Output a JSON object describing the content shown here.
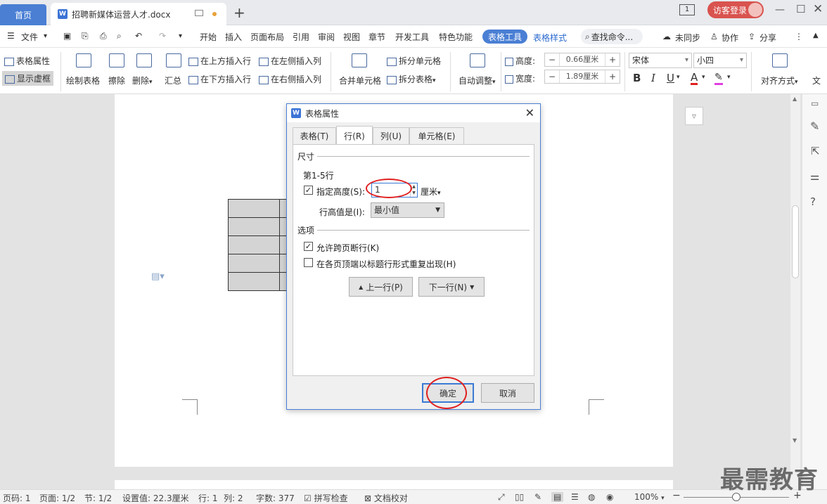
{
  "titlebar": {
    "home_tab": "首页",
    "doc_tab": "招聘新媒体运营人才.docx",
    "new_tab": "+",
    "page_badge": "1",
    "login": "访客登录"
  },
  "menubar": {
    "file": "文件",
    "items": [
      "开始",
      "插入",
      "页面布局",
      "引用",
      "审阅",
      "视图",
      "章节",
      "开发工具",
      "特色功能"
    ],
    "table_tools": "表格工具",
    "table_style": "表格样式",
    "search": "查找命令...",
    "sync": "未同步",
    "collab": "协作",
    "share": "分享"
  },
  "ribbon": {
    "table_props": "表格属性",
    "show_grid": "显示虚框",
    "draw_table": "绘制表格",
    "erase": "擦除",
    "delete": "删除",
    "summary": "汇总",
    "insert_above": "在上方插入行",
    "insert_below": "在下方插入行",
    "insert_left": "在左侧插入列",
    "insert_right": "在右侧插入列",
    "merge": "合并单元格",
    "split_cell": "拆分单元格",
    "split_table": "拆分表格",
    "autofit": "自动调整",
    "height_label": "高度:",
    "height_value": "0.66厘米",
    "width_label": "宽度:",
    "width_value": "1.89厘米",
    "font": "宋体",
    "font_size": "小四",
    "bold": "B",
    "italic": "I",
    "underline": "U",
    "font_color": "A",
    "align": "对齐方式",
    "text_dir": "文"
  },
  "dialog": {
    "title": "表格属性",
    "tabs": [
      "表格(T)",
      "行(R)",
      "列(U)",
      "单元格(E)"
    ],
    "active_tab": 1,
    "section_size": "尺寸",
    "rows_label": "第1-5行",
    "specify_height": "指定高度(S):",
    "height_value": "1",
    "unit": "厘米",
    "row_height_is": "行高值是(I):",
    "row_height_mode": "最小值",
    "section_options": "选项",
    "allow_break": "允许跨页断行(K)",
    "repeat_header": "在各页顶端以标题行形式重复出现(H)",
    "prev_row": "上一行(P)",
    "next_row": "下一行(N)",
    "ok": "确定",
    "cancel": "取消"
  },
  "statusbar": {
    "page_num": "页码: 1",
    "page": "页面: 1/2",
    "section": "节: 1/2",
    "setting": "设置值: 22.3厘米",
    "row": "行: 1",
    "col": "列: 2",
    "words": "字数: 377",
    "spell": "拼写检查",
    "proof": "文档校对",
    "zoom": "100%"
  },
  "watermark": "最需教育",
  "colors": {
    "accent": "#4a7fd4",
    "highlight_circle": "#e02020",
    "login": "#d9534f"
  }
}
